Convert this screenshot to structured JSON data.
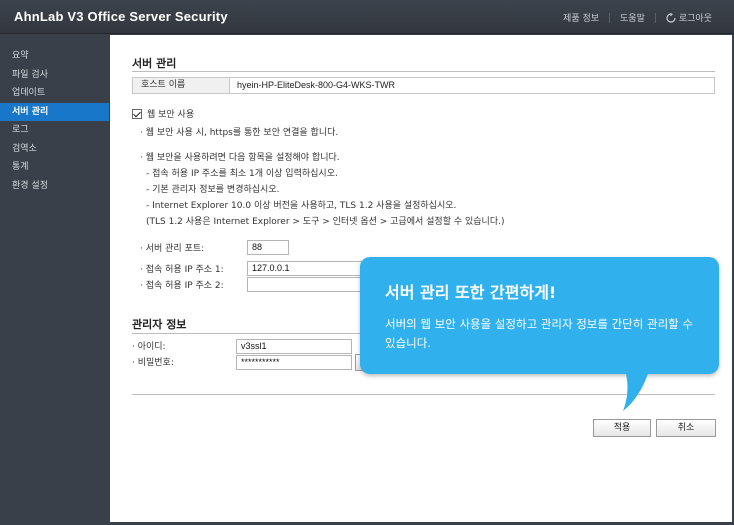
{
  "app": {
    "title": "AhnLab V3 Office Server Security",
    "links": [
      "제품 정보",
      "도움말",
      "로그아웃"
    ]
  },
  "sidebar": {
    "items": [
      {
        "label": "요약",
        "active": false
      },
      {
        "label": "파일 검사",
        "active": false
      },
      {
        "label": "업데이트",
        "active": false
      },
      {
        "label": "서버 관리",
        "active": true
      },
      {
        "label": "로그",
        "active": false
      },
      {
        "label": "검역소",
        "active": false
      },
      {
        "label": "통계",
        "active": false
      },
      {
        "label": "환경 설정",
        "active": false
      }
    ]
  },
  "server_mgmt": {
    "title": "서버 관리",
    "host_label": "호스트 이름",
    "host_value": "hyein-HP-EliteDesk-800-G4-WKS-TWR",
    "web_security_label": "웹 보안 사용",
    "web_security_checked": true,
    "note1": "· 웹 보안 사용 시, https를 통한 보안 연결을 합니다.",
    "note2": "· 웹 보안을 사용하려면 다음 항목을 설정해야 합니다.",
    "note2_items": [
      "- 접속 허용 IP 주소를 최소 1개 이상 입력하십시오.",
      "- 기본 관리자 정보를 변경하십시오.",
      "- Internet Explorer 10.0 이상 버전을 사용하고, TLS 1.2 사용을 설정하십시오.",
      "(TLS 1.2 사용은 Internet Explorer > 도구 > 인터넷 옵션 > 고급에서 설정할 수 있습니다.)"
    ],
    "port_label": "· 서버 관리 포트:",
    "port_value": "88",
    "ip1_label": "· 접속 허용 IP 주소 1:",
    "ip1_value": "127.0.0.1",
    "ip2_label": "· 접속 허용 IP 주소 2:",
    "ip2_value": ""
  },
  "admin": {
    "title": "관리자 정보",
    "id_label": "· 아이디:",
    "id_value": "v3ssl1",
    "pw_label": "· 비밀번호:",
    "pw_value": "***********"
  },
  "buttons": {
    "apply": "적용",
    "cancel": "취소"
  },
  "callout": {
    "title": "서버 관리 또한 간편하게!",
    "body": "서버의 웹 보안 사용을 설정하고 관리자 정보를 간단히 관리할 수 있습니다.",
    "color": "#30b0ed"
  },
  "colors": {
    "active_nav": "#1877c9",
    "sidebar_bg": "#3a4049"
  }
}
